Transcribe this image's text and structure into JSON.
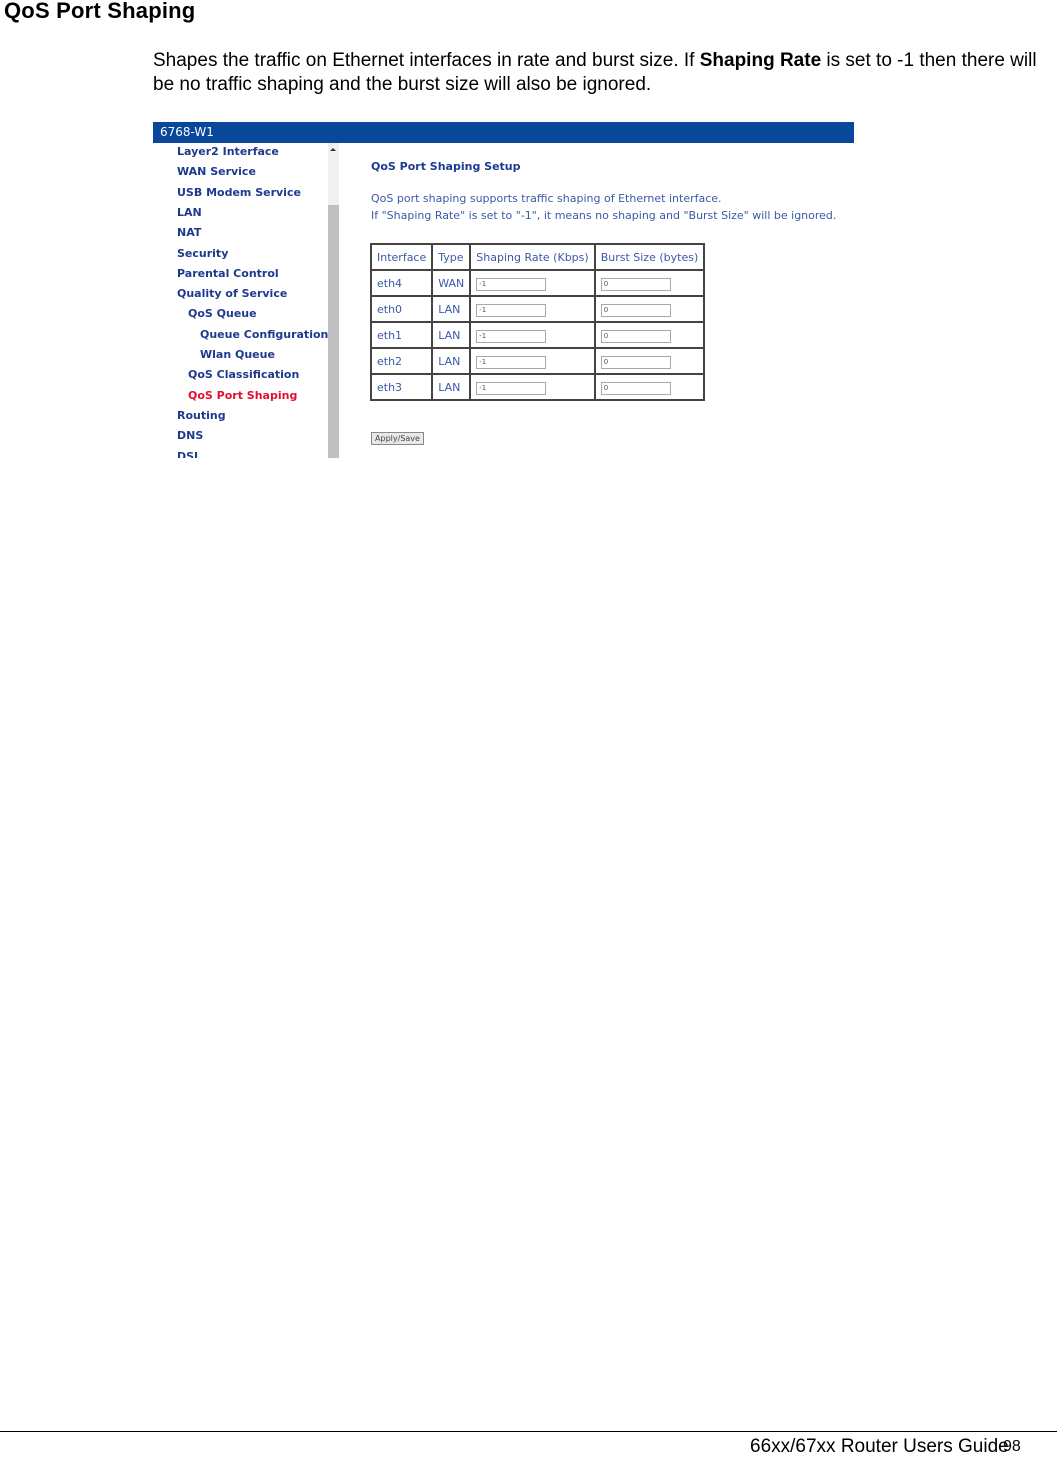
{
  "document": {
    "title": "QoS Port Shaping",
    "intro_part1": "Shapes the traffic on Ethernet interfaces in rate and burst size. If ",
    "intro_bold": "Shaping Rate",
    "intro_part2": " is set to -1 then there will be no traffic shaping and the burst size will also be ignored.",
    "footer_title": "66xx/67xx Router Users Guide",
    "page_number": "98"
  },
  "screenshot": {
    "header_title": "6768-W1",
    "header_color": "#08479a",
    "sidebar": {
      "items": [
        {
          "label": "Layer2 Interface",
          "level": 0
        },
        {
          "label": "WAN Service",
          "level": 0
        },
        {
          "label": "USB Modem Service",
          "level": 0
        },
        {
          "label": "LAN",
          "level": 0
        },
        {
          "label": "NAT",
          "level": 0
        },
        {
          "label": "Security",
          "level": 0
        },
        {
          "label": "Parental Control",
          "level": 0
        },
        {
          "label": "Quality of Service",
          "level": 0
        },
        {
          "label": "QoS Queue",
          "level": 1
        },
        {
          "label": "Queue Configuration",
          "level": 2
        },
        {
          "label": "Wlan Queue",
          "level": 2
        },
        {
          "label": "QoS Classification",
          "level": 1
        },
        {
          "label": "QoS Port Shaping",
          "level": 1,
          "active": true
        },
        {
          "label": "Routing",
          "level": 0
        },
        {
          "label": "DNS",
          "level": 0
        },
        {
          "label": "DSL",
          "level": 0
        }
      ],
      "active_color": "#e0102e"
    },
    "main": {
      "title": "QoS Port Shaping Setup",
      "description_line1": "QoS port shaping supports traffic shaping of Ethernet interface.",
      "description_line2": "If \"Shaping Rate\" is set to \"-1\", it means no shaping and \"Burst Size\" will be ignored.",
      "table": {
        "headers": [
          "Interface",
          "Type",
          "Shaping Rate (Kbps)",
          "Burst Size (bytes)"
        ],
        "rows": [
          {
            "interface": "eth4",
            "type": "WAN",
            "shaping_rate": "-1",
            "burst_size": "0"
          },
          {
            "interface": "eth0",
            "type": "LAN",
            "shaping_rate": "-1",
            "burst_size": "0"
          },
          {
            "interface": "eth1",
            "type": "LAN",
            "shaping_rate": "-1",
            "burst_size": "0"
          },
          {
            "interface": "eth2",
            "type": "LAN",
            "shaping_rate": "-1",
            "burst_size": "0"
          },
          {
            "interface": "eth3",
            "type": "LAN",
            "shaping_rate": "-1",
            "burst_size": "0"
          }
        ]
      },
      "apply_label": "Apply/Save"
    }
  }
}
